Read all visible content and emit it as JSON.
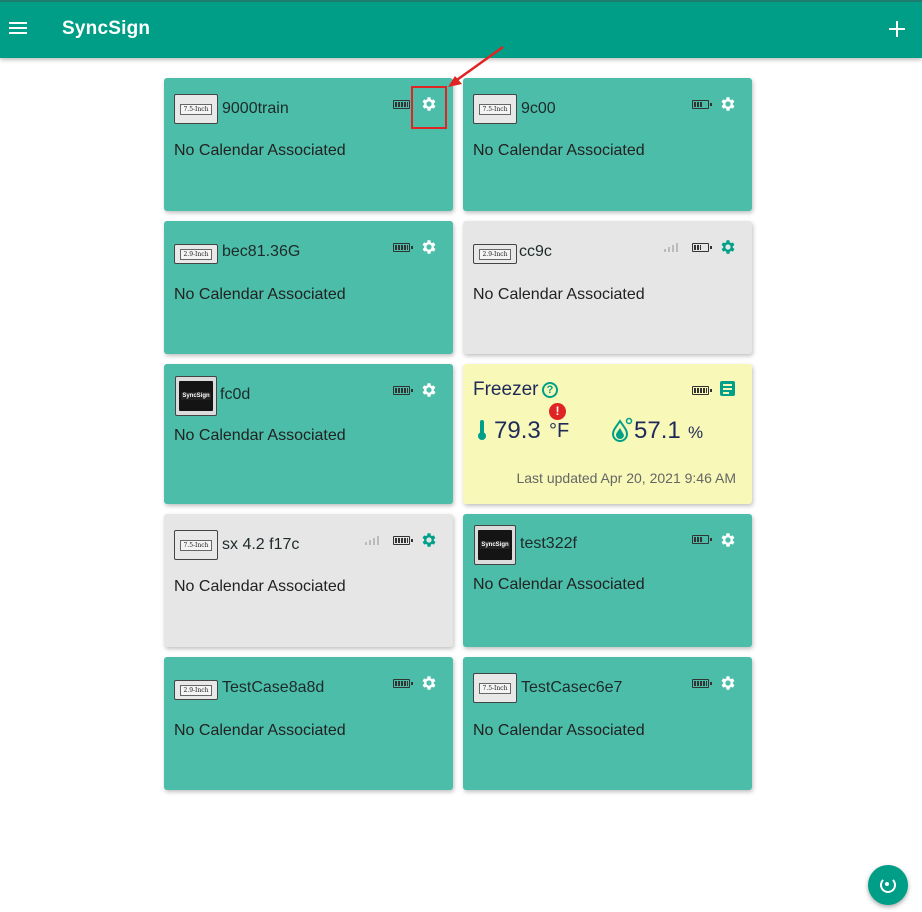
{
  "app": {
    "title": "SyncSign"
  },
  "colors": {
    "primary": "#009e86",
    "card_teal": "#4bbda8",
    "card_grey": "#e6e6e6",
    "card_yellow": "#f8f8b8",
    "alert_red": "#e02424"
  },
  "icons": {
    "menu": "hamburger-menu-icon",
    "add": "plus-icon",
    "settings": "gear-icon",
    "battery": "battery-icon",
    "signal": "signal-icon",
    "refresh": "refresh-icon",
    "note": "note-icon",
    "help": "help-circle-icon"
  },
  "devices": [
    {
      "name": "9000train",
      "thumb": "7.5-Inch",
      "calendar": "No Calendar Associated"
    },
    {
      "name": "9c00",
      "thumb": "7.5-Inch",
      "calendar": "No Calendar Associated"
    },
    {
      "name": "bec81.36G",
      "thumb": "2.9-Inch",
      "calendar": "No Calendar Associated"
    },
    {
      "name": "cc9c",
      "thumb": "2.9-Inch",
      "calendar": "No Calendar Associated"
    },
    {
      "name": "fc0d",
      "thumb": "SyncSign",
      "calendar": "No Calendar Associated"
    },
    {
      "name": "sx 4.2 f17c",
      "thumb": "7.5-Inch",
      "calendar": "No Calendar Associated"
    },
    {
      "name": "test322f",
      "thumb": "SyncSign",
      "calendar": "No Calendar Associated"
    },
    {
      "name": "TestCase8a8d",
      "thumb": "2.9-Inch",
      "calendar": "No Calendar Associated"
    },
    {
      "name": "TestCasec6e7",
      "thumb": "7.5-Inch",
      "calendar": "No Calendar Associated"
    }
  ],
  "sensor": {
    "name": "Freezer",
    "help": "?",
    "alert": "!",
    "temperature": "79.3",
    "temperature_unit": "°F",
    "humidity": "57.1",
    "humidity_unit": "%",
    "last_updated": "Last updated Apr 20, 2021 9:46 AM"
  }
}
